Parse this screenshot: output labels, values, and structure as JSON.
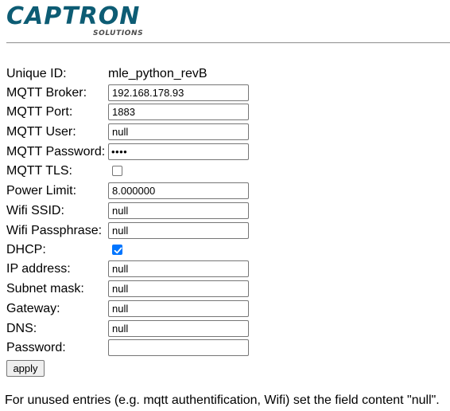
{
  "logo": {
    "main": "CAPTRON",
    "sub": "SOLUTIONS",
    "color": "#0d5c74"
  },
  "form": {
    "unique_id": {
      "label": "Unique ID:",
      "value": "mle_python_revB"
    },
    "mqtt_broker": {
      "label": "MQTT Broker:",
      "value": "192.168.178.93"
    },
    "mqtt_port": {
      "label": "MQTT Port:",
      "value": "1883"
    },
    "mqtt_user": {
      "label": "MQTT User:",
      "value": "null"
    },
    "mqtt_password": {
      "label": "MQTT Password:",
      "value": "••••"
    },
    "mqtt_tls": {
      "label": "MQTT TLS:",
      "checked": false
    },
    "power_limit": {
      "label": "Power Limit:",
      "value": "8.000000"
    },
    "wifi_ssid": {
      "label": "Wifi SSID:",
      "value": "null"
    },
    "wifi_passphrase": {
      "label": "Wifi Passphrase:",
      "value": "null"
    },
    "dhcp": {
      "label": "DHCP:",
      "checked": true
    },
    "ip_address": {
      "label": "IP address:",
      "value": "null"
    },
    "subnet_mask": {
      "label": "Subnet mask:",
      "value": "null"
    },
    "gateway": {
      "label": "Gateway:",
      "value": "null"
    },
    "dns": {
      "label": "DNS:",
      "value": "null"
    },
    "password": {
      "label": "Password:",
      "value": ""
    },
    "apply_label": "apply"
  },
  "note": "For unused entries (e.g. mqtt authentification, Wifi) set the field content \"null\".",
  "colors": {
    "checkbox_checked": "#0075ff"
  }
}
